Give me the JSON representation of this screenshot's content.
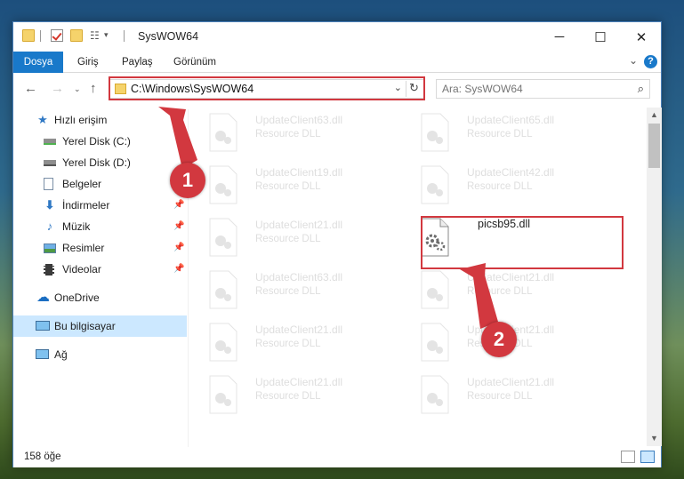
{
  "window": {
    "title": "SysWOW64",
    "controls": {
      "minimize": "─",
      "maximize": "☐",
      "close": "✕"
    }
  },
  "ribbon": {
    "tabs": [
      {
        "label": "Dosya",
        "active": true
      },
      {
        "label": "Giriş"
      },
      {
        "label": "Paylaş"
      },
      {
        "label": "Görünüm"
      }
    ],
    "help": "?"
  },
  "nav": {
    "address_path": "C:\\Windows\\SysWOW64",
    "search_placeholder": "Ara: SysWOW64"
  },
  "sidebar": {
    "items": [
      {
        "label": "Hızlı erişim",
        "icon": "star-icon"
      },
      {
        "label": "Yerel Disk (C:)",
        "icon": "drive-icon"
      },
      {
        "label": "Yerel Disk (D:)",
        "icon": "drive-icon"
      },
      {
        "label": "Belgeler",
        "icon": "documents-icon"
      },
      {
        "label": "İndirmeler",
        "icon": "download-icon"
      },
      {
        "label": "Müzik",
        "icon": "music-icon"
      },
      {
        "label": "Resimler",
        "icon": "pictures-icon"
      },
      {
        "label": "Videolar",
        "icon": "video-icon"
      },
      {
        "label": "OneDrive",
        "icon": "cloud-icon"
      },
      {
        "label": "Bu bilgisayar",
        "icon": "computer-icon",
        "selected": true
      },
      {
        "label": "Ağ",
        "icon": "network-icon"
      }
    ]
  },
  "files": [
    {
      "name": "UpdateClient63.dll",
      "type": "Resource DLL"
    },
    {
      "name": "UpdateClient65.dll",
      "type": "Resource DLL"
    },
    {
      "name": "UpdateClient19.dll",
      "type": "Resource DLL"
    },
    {
      "name": "UpdateClient42.dll",
      "type": "Resource DLL"
    },
    {
      "name": "UpdateClient21.dll",
      "type": "Resource DLL"
    },
    {
      "name": "picsb95.dll",
      "type": "",
      "highlighted": true
    },
    {
      "name": "UpdateClient63.dll",
      "type": "Resource DLL"
    },
    {
      "name": "UpdateClient21.dll",
      "type": "Resource DLL"
    },
    {
      "name": "UpdateClient21.dll",
      "type": "Resource DLL"
    },
    {
      "name": "UpdateClient21.dll",
      "type": "Resource DLL"
    },
    {
      "name": "UpdateClient21.dll",
      "type": "Resource DLL"
    },
    {
      "name": "UpdateClient21.dll",
      "type": "Resource DLL"
    }
  ],
  "status": {
    "item_count": "158 öğe"
  },
  "callouts": [
    "1",
    "2"
  ],
  "colors": {
    "accent": "#1979ca",
    "annotation_red": "#d2383f",
    "selected_bg": "#cce8ff"
  }
}
